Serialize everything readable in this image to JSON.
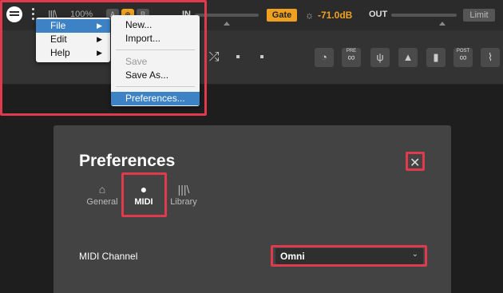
{
  "header": {
    "zoom": "100%",
    "mode_buttons": [
      "A",
      "B"
    ],
    "in_label": "IN",
    "gate_label": "Gate",
    "level": "-71.0dB",
    "out_label": "OUT",
    "limit_label": "Limit"
  },
  "toolbar": {
    "pre_label": "PRE",
    "post_label": "POST"
  },
  "menu": {
    "items": [
      {
        "label": "File",
        "arrow": "▶"
      },
      {
        "label": "Edit",
        "arrow": "▶"
      },
      {
        "label": "Help",
        "arrow": "▶"
      }
    ]
  },
  "submenu": {
    "items": [
      {
        "label": "New..."
      },
      {
        "label": "Import..."
      },
      {
        "label": "Save"
      },
      {
        "label": "Save As..."
      },
      {
        "label": "Preferences..."
      }
    ]
  },
  "dialog": {
    "title": "Preferences",
    "tabs": [
      {
        "label": "General",
        "icon": "home-icon"
      },
      {
        "label": "MIDI",
        "icon": "midi-icon"
      },
      {
        "label": "Library",
        "icon": "library-icon"
      }
    ],
    "midi_channel_label": "MIDI Channel",
    "midi_channel_value": "Omni"
  },
  "colors": {
    "accent": "#f0a020",
    "highlight": "#e03a4e",
    "menu_selection": "#3d82c4"
  }
}
